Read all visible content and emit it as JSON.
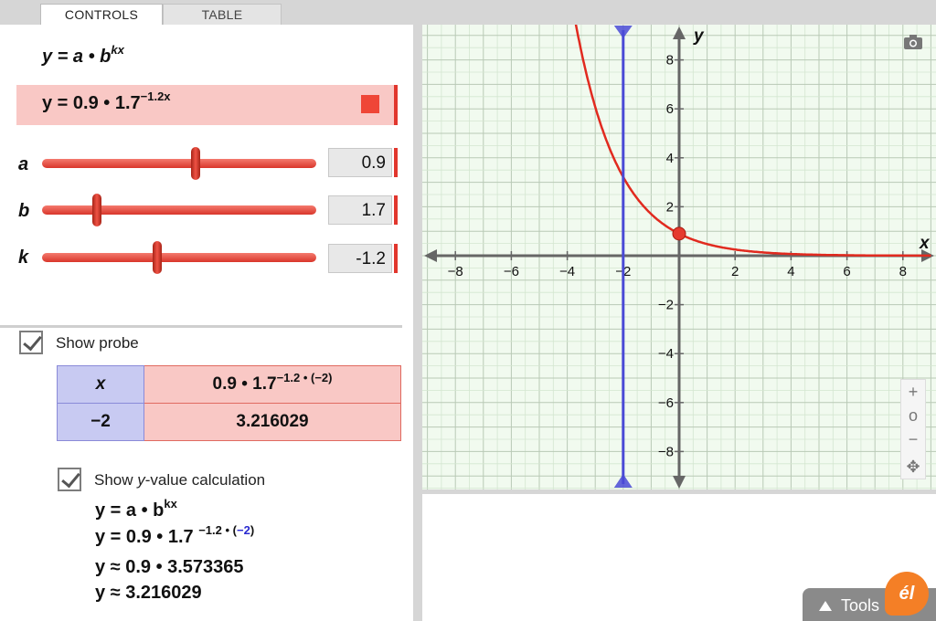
{
  "tabs": [
    {
      "label": "CONTROLS"
    },
    {
      "label": "TABLE"
    }
  ],
  "controls": {
    "formula_general": "y = a • b",
    "formula_general_exp": "kx",
    "formula_current": "y = 0.9 • 1.7",
    "formula_current_exp": "−1.2x",
    "curve_color": "#ef4637",
    "sliders": [
      {
        "label": "a",
        "value": "0.9",
        "level": 0.56
      },
      {
        "label": "b",
        "value": "1.7",
        "level": 0.2
      },
      {
        "label": "k",
        "value": "-1.2",
        "level": 0.42
      }
    ]
  },
  "probe": {
    "checkbox_label": "Show probe",
    "checked": true,
    "header_x": "x",
    "header_expr": "0.9 • 1.7",
    "header_expr_exp": "−1.2 • (−2)",
    "x_value": "−2",
    "y_value": "3.216029"
  },
  "calculation": {
    "checkbox_pre": "Show ",
    "checkbox_em": "y",
    "checkbox_post": "-value calculation",
    "checked": true,
    "line1": "y = a • b",
    "line1_exp": "kx",
    "line2": "y = 0.9 • 1.7 ",
    "line2_exp": "−1.2 • (",
    "line2_blue": "−2",
    "line2_end": ")",
    "line3": "y ≈ 0.9 • 3.573365",
    "line4": "y ≈ 3.216029"
  },
  "graph": {
    "x_axis_label": "x",
    "y_axis_label": "y",
    "x_ticks": [
      "−8",
      "−6",
      "−4",
      "−2",
      "2",
      "4",
      "6",
      "8"
    ],
    "y_ticks": [
      "8",
      "6",
      "4",
      "2",
      "−2",
      "−4",
      "−6",
      "−8"
    ],
    "xlim": [
      -9,
      9
    ],
    "ylim": [
      -9.3,
      9.3
    ],
    "a": 0.9,
    "b": 1.7,
    "k": -1.2,
    "probe_x": -2,
    "curve_color": "#e12a1f",
    "probe_color": "#4a4ad6",
    "grid_color": "#e7f6e4"
  },
  "zoom": {
    "plus": "+",
    "reset": "o",
    "minus": "−",
    "pan": "✥"
  },
  "tools": {
    "label": "Tools"
  }
}
